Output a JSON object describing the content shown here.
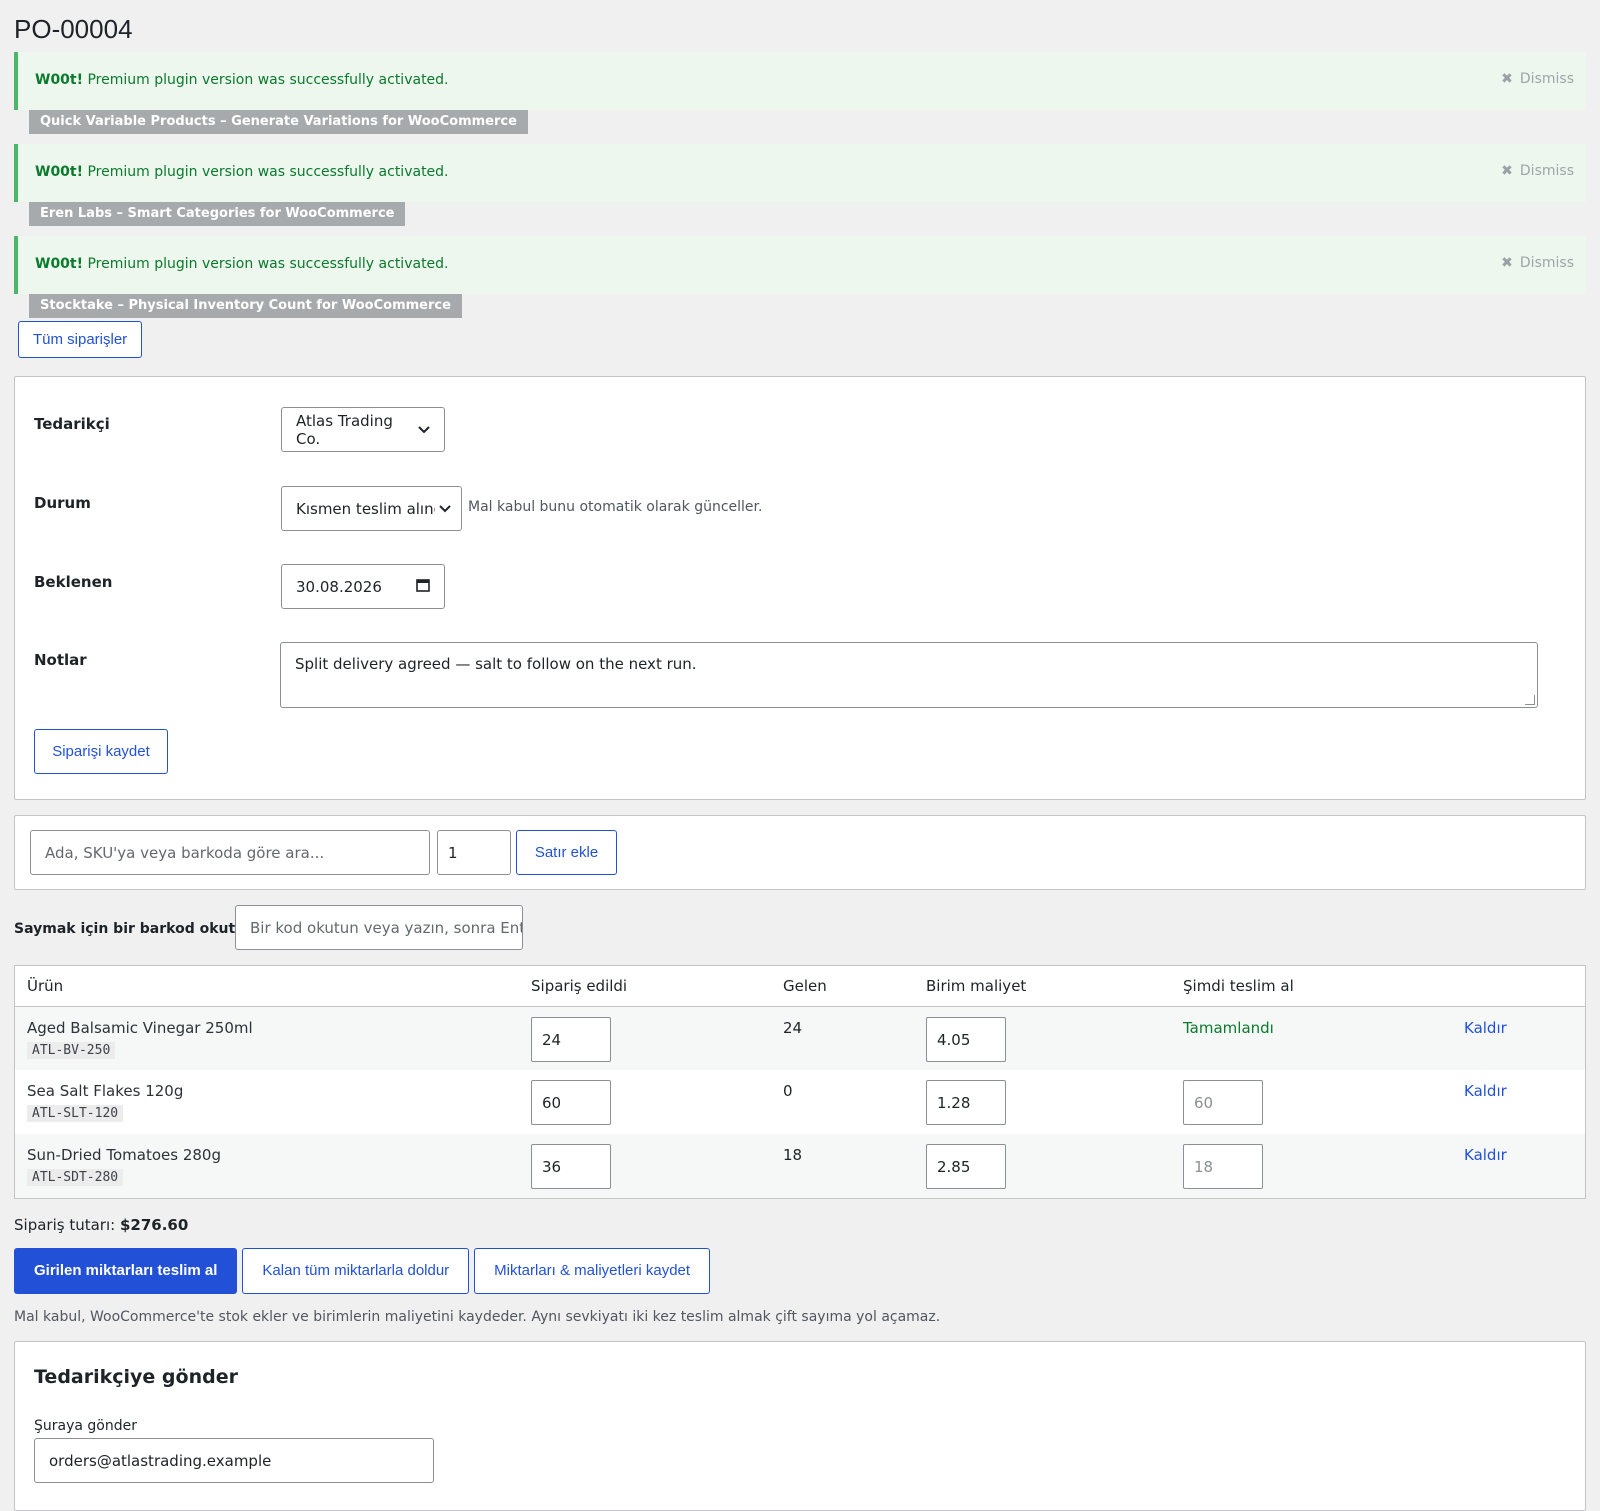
{
  "page": {
    "title": "PO-00004"
  },
  "notices": [
    {
      "strong": "W00t!",
      "message": "Premium plugin version was successfully activated.",
      "dismiss": "Dismiss",
      "plugin": "Quick Variable Products – Generate Variations for WooCommerce"
    },
    {
      "strong": "W00t!",
      "message": "Premium plugin version was successfully activated.",
      "dismiss": "Dismiss",
      "plugin": "Eren Labs – Smart Categories for WooCommerce"
    },
    {
      "strong": "W00t!",
      "message": "Premium plugin version was successfully activated.",
      "dismiss": "Dismiss",
      "plugin": "Stocktake – Physical Inventory Count for WooCommerce"
    }
  ],
  "all_orders_label": "Tüm siparişler",
  "form": {
    "supplier_label": "Tedarikçi",
    "supplier_value": "Atlas Trading Co.",
    "status_label": "Durum",
    "status_value": "Kısmen teslim alındı",
    "status_hint": "Mal kabul bunu otomatik olarak günceller.",
    "expected_label": "Beklenen",
    "expected_value": "30.08.2026",
    "notes_label": "Notlar",
    "notes_value": "Split delivery agreed — salt to follow on the next run.",
    "save_label": "Siparişi kaydet"
  },
  "add_line": {
    "search_placeholder": "Ada, SKU'ya veya barkoda göre ara...",
    "qty_value": "1",
    "add_label": "Satır ekle"
  },
  "scan": {
    "label": "Saymak için bir barkod okutun:",
    "placeholder": "Bir kod okutun veya yazın, sonra Ente"
  },
  "table": {
    "headers": [
      "Ürün",
      "Sipariş edildi",
      "Gelen",
      "Birim maliyet",
      "Şimdi teslim al",
      ""
    ],
    "rows": [
      {
        "name": "Aged Balsamic Vinegar 250ml",
        "sku": "ATL-BV-250",
        "ordered": "24",
        "received": "24",
        "cost": "4.05",
        "receive_now": "Tamamlandı",
        "remove": "Kaldır"
      },
      {
        "name": "Sea Salt Flakes 120g",
        "sku": "ATL-SLT-120",
        "ordered": "60",
        "received": "0",
        "cost": "1.28",
        "receive_now": "60",
        "remove": "Kaldır"
      },
      {
        "name": "Sun-Dried Tomatoes 280g",
        "sku": "ATL-SDT-280",
        "ordered": "36",
        "received": "18",
        "cost": "2.85",
        "receive_now": "18",
        "remove": "Kaldır"
      }
    ]
  },
  "total": {
    "label": "Sipariş tutarı:",
    "value": "$276.60"
  },
  "actions": {
    "receive": "Girilen miktarları teslim al",
    "fill": "Kalan tüm miktarlarla doldur",
    "save": "Miktarları & maliyetleri kaydet"
  },
  "receive_note": "Mal kabul, WooCommerce'te stok ekler ve birimlerin maliyetini kaydeder. Aynı sevkiyatı iki kez teslim almak çift sayıma yol açamaz.",
  "send": {
    "title": "Tedarikçiye gönder",
    "to_label": "Şuraya gönder",
    "to_value": "orders@atlastrading.example"
  },
  "colors": {
    "accent": "#2251d8",
    "success": "#0a7a2d",
    "notice_bg": "#edf7ee",
    "notice_border": "#4ab866",
    "badge": "#a7aaad"
  },
  "icons": {
    "dismiss": "close-icon",
    "select": "chevron-down-icon",
    "date": "calendar-icon"
  }
}
